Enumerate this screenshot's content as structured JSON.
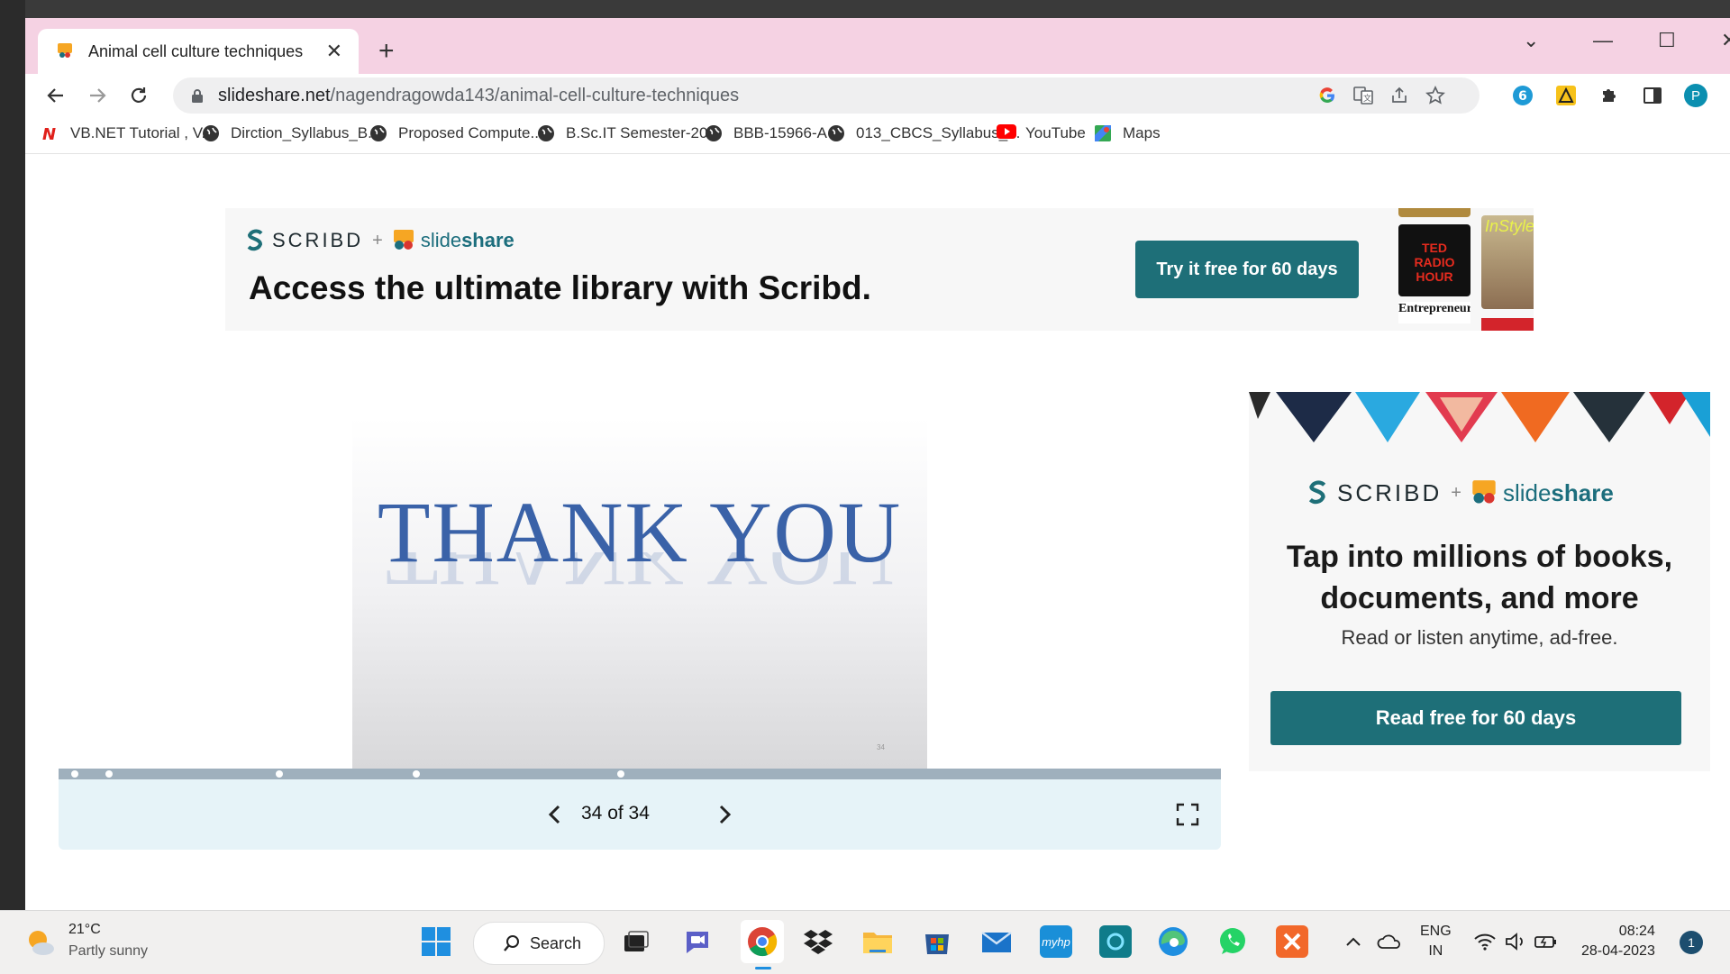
{
  "browser": {
    "tab_title": "Animal cell culture techniques",
    "url_host": "slideshare.net",
    "url_path": "/nagendragowda143/animal-cell-culture-techniques",
    "profile_initial": "P"
  },
  "bookmarks": [
    {
      "label": "VB.NET Tutorial , V...",
      "icon": "vbnet-icon"
    },
    {
      "label": "Dirction_Syllabus_B...",
      "icon": "globe-icon"
    },
    {
      "label": "Proposed Compute...",
      "icon": "globe-icon"
    },
    {
      "label": "B.Sc.IT Semester-20...",
      "icon": "globe-icon"
    },
    {
      "label": "BBB-15966-A",
      "icon": "globe-icon"
    },
    {
      "label": "013_CBCS_Syllabus_...",
      "icon": "globe-icon"
    },
    {
      "label": "YouTube",
      "icon": "youtube-icon"
    },
    {
      "label": "Maps",
      "icon": "maps-icon"
    }
  ],
  "top_banner": {
    "brand_scribd": "SCRIBD",
    "brand_plus": "+",
    "brand_slide": "slide",
    "brand_share": "share",
    "headline": "Access the ultimate library with Scribd.",
    "cta": "Try it free for 60 days",
    "magazines": [
      "TED RADIO HOUR",
      "InStyle",
      "Entrepreneur"
    ]
  },
  "slide_player": {
    "slide_title": "THANK YOU",
    "slide_number": "34",
    "page_counter": "34 of 34"
  },
  "side_ad": {
    "brand_scribd": "SCRIBD",
    "brand_plus": "+",
    "brand_slide": "slide",
    "brand_share": "share",
    "headline_line1": "Tap into millions of books,",
    "headline_line2": "documents, and more",
    "subtext": "Read or listen anytime, ad-free.",
    "cta": "Read free for 60 days"
  },
  "taskbar": {
    "weather_temp": "21°C",
    "weather_desc": "Partly sunny",
    "search_label": "Search",
    "lang_line1": "ENG",
    "lang_line2": "IN",
    "time": "08:24",
    "date": "28-04-2023",
    "notification_count": "1"
  },
  "colors": {
    "tab_strip": "#f5d2e3",
    "scribd_teal": "#1e6f78",
    "slide_title": "#3a62a8",
    "controls_bg": "#e6f3f8"
  }
}
